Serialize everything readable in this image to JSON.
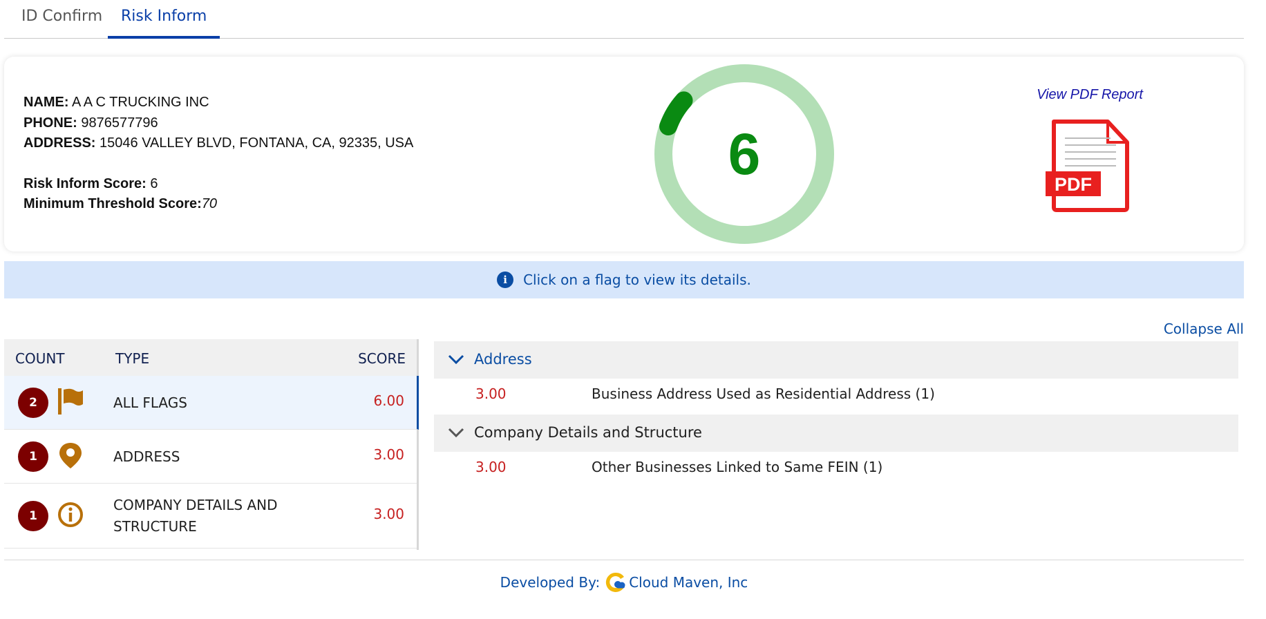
{
  "tabs": [
    {
      "label": "ID Confirm",
      "active": false
    },
    {
      "label": "Risk Inform",
      "active": true
    }
  ],
  "summary": {
    "name_label": "NAME:",
    "name_value": "A A C TRUCKING INC",
    "phone_label": "PHONE:",
    "phone_value": "9876577796",
    "address_label": "ADDRESS:",
    "address_value": "15046 VALLEY BLVD, FONTANA, CA, 92335, USA",
    "score_label": "Risk Inform Score:",
    "score_value": "6",
    "threshold_label": "Minimum Threshold Score:",
    "threshold_value": "70"
  },
  "gauge": {
    "value": "6",
    "fraction": 0.06,
    "track_color": "#b3dfb6",
    "fill_color": "#0a8a12"
  },
  "report": {
    "link_label": "View PDF Report",
    "icon_text": "PDF",
    "icon": "pdf-file-icon"
  },
  "banner": {
    "text": "Click on a flag to view its details.",
    "icon": "info-icon"
  },
  "collapse_all_label": "Collapse All",
  "flags_table": {
    "headers": {
      "count": "COUNT",
      "type": "TYPE",
      "score": "SCORE"
    },
    "rows": [
      {
        "count": "2",
        "icon": "flag-icon",
        "type": "ALL FLAGS",
        "score": "6.00",
        "selected": true
      },
      {
        "count": "1",
        "icon": "map-pin-icon",
        "type": "ADDRESS",
        "score": "3.00",
        "selected": false
      },
      {
        "count": "1",
        "icon": "info-circle-icon",
        "type_line1": "COMPANY DETAILS AND",
        "type_line2": "STRUCTURE",
        "score": "3.00",
        "selected": false
      }
    ]
  },
  "details": [
    {
      "group": "Address",
      "expanded": true,
      "color": "#0a4da3",
      "items": [
        {
          "score": "3.00",
          "text": "Business Address Used as Residential Address (1)"
        }
      ]
    },
    {
      "group": "Company Details and Structure",
      "expanded": true,
      "color": "#202020",
      "items": [
        {
          "score": "3.00",
          "text": "Other Businesses Linked to Same FEIN (1)"
        }
      ]
    }
  ],
  "footer": {
    "developed_by": "Developed By:",
    "company": "Cloud Maven, Inc",
    "logo": "cloud-maven-logo-icon"
  },
  "colors": {
    "accent": "#0a4da3",
    "badge": "#7c0000",
    "flag_icon": "#b8700a",
    "score_red": "#c62020"
  }
}
